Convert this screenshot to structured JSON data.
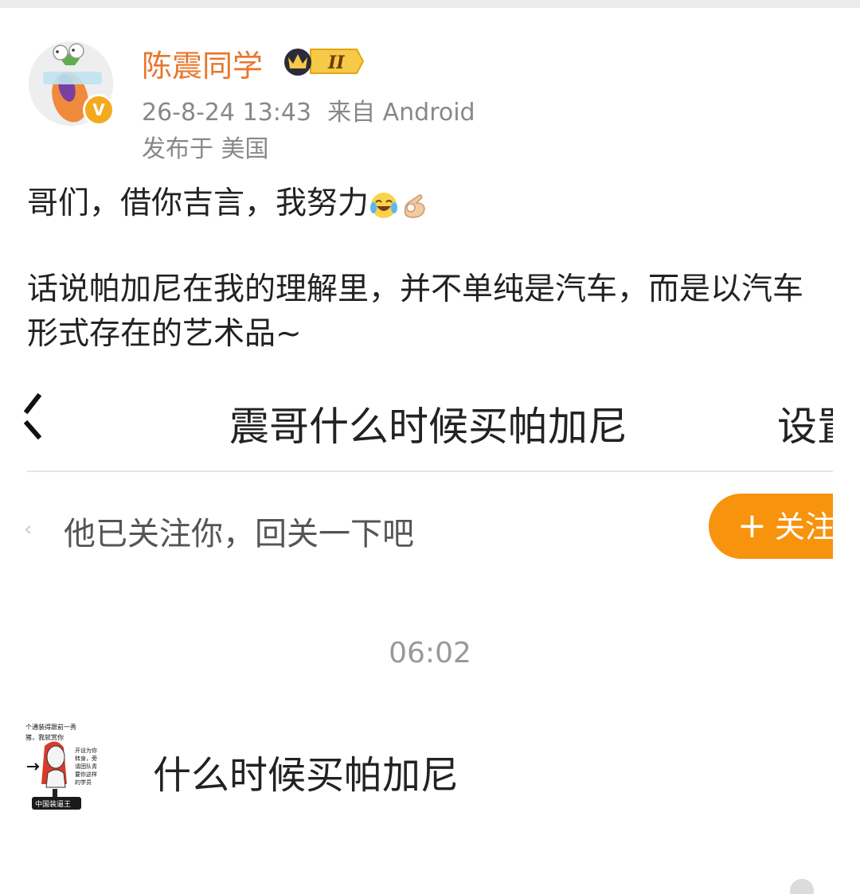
{
  "post": {
    "username": "陈震同学",
    "member_badge": "II",
    "timestamp": "26-8-24 13:43",
    "source": "来自 Android",
    "location": "发布于 美国",
    "line1": "哥们，借你吉言，我努力",
    "paragraph2": "话说帕加尼在我的理解里，并不单纯是汽车，而是以汽车形式存在的艺术品~",
    "emojis": [
      "laughing-crying-emoji",
      "ok-hand-emoji"
    ]
  },
  "chat": {
    "title": "震哥什么时候买帕加尼",
    "settings": "设置",
    "follow_tip": "他已关注你，回关一下吧",
    "follow_button": "关注",
    "time": "06:02",
    "message": "什么时候买帕加尼",
    "sticker_lines": [
      "个通装得跟前一秀",
      "猪，我就赏你",
      "开设为你",
      "转身，旁",
      "请团队青",
      "要你这样",
      "的学员",
      "中国装逼王"
    ]
  },
  "colors": {
    "username": "#e8762d",
    "meta": "#888888",
    "follow_button": "#f7930d",
    "verified_badge": "#f5a91e"
  }
}
